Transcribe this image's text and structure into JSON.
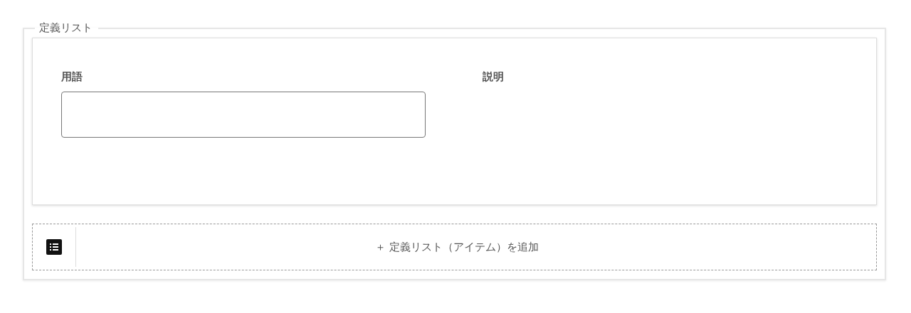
{
  "group": {
    "legend": "定義リスト"
  },
  "item": {
    "term_label": "用語",
    "description_label": "説明"
  },
  "add_bar": {
    "label": "＋ 定義リスト（アイテム）を追加"
  }
}
